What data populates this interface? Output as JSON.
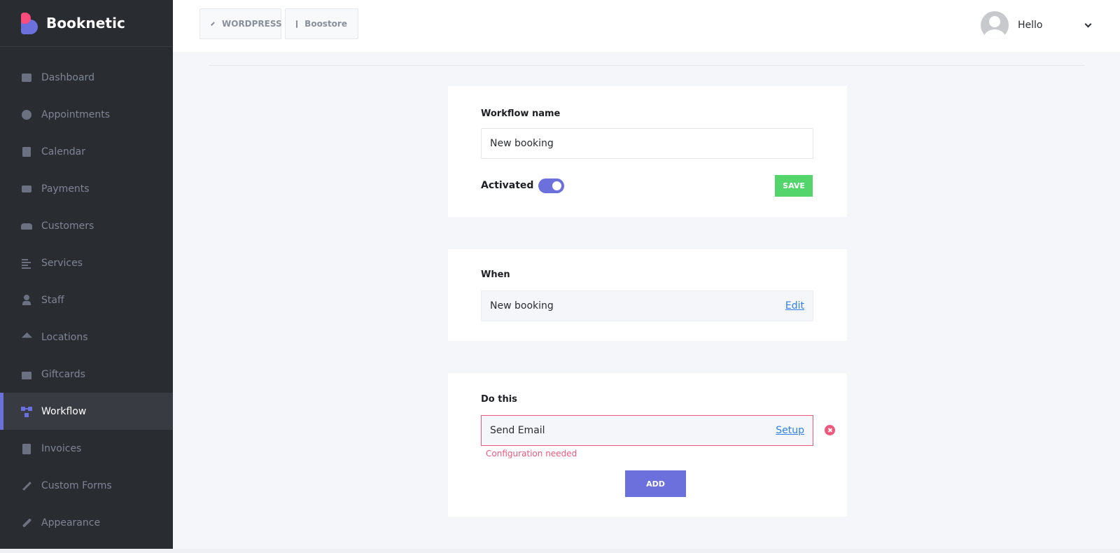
{
  "brand": {
    "name": "Booknetic",
    "colors": {
      "pink": "#fc4c7b",
      "purple": "#6c70dc"
    }
  },
  "sidebar": {
    "items": [
      {
        "label": "Dashboard",
        "icon": "cube-icon"
      },
      {
        "label": "Appointments",
        "icon": "clock-icon"
      },
      {
        "label": "Calendar",
        "icon": "calendar-icon"
      },
      {
        "label": "Payments",
        "icon": "wallet-icon"
      },
      {
        "label": "Customers",
        "icon": "users-icon"
      },
      {
        "label": "Services",
        "icon": "list-icon"
      },
      {
        "label": "Staff",
        "icon": "user-icon"
      },
      {
        "label": "Locations",
        "icon": "location-arrow-icon"
      },
      {
        "label": "Giftcards",
        "icon": "gift-icon"
      },
      {
        "label": "Workflow",
        "icon": "workflow-icon",
        "active": true
      },
      {
        "label": "Invoices",
        "icon": "file-icon"
      },
      {
        "label": "Custom Forms",
        "icon": "magic-wand-icon"
      },
      {
        "label": "Appearance",
        "icon": "brush-icon"
      }
    ]
  },
  "topbar": {
    "wordpress_label": "WORDPRESS",
    "boostore_label": "Boostore",
    "user_greeting": "Hello"
  },
  "workflow": {
    "name_label": "Workflow name",
    "name_value": "New booking",
    "activated_label": "Activated",
    "activated": true,
    "save_label": "SAVE"
  },
  "when": {
    "title": "When",
    "event": "New booking",
    "edit_label": "Edit"
  },
  "do_this": {
    "title": "Do this",
    "action": "Send Email",
    "setup_label": "Setup",
    "error": "Configuration needed",
    "add_label": "ADD"
  }
}
